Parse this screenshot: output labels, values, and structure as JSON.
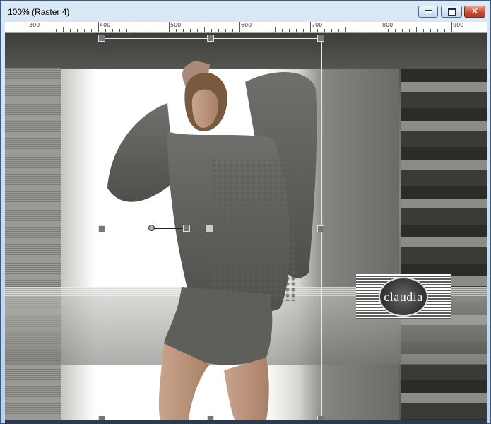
{
  "window": {
    "title": "100% (Raster 4)"
  },
  "controls": {
    "minimize": "minimize-icon",
    "maximize": "maximize-icon",
    "close": "close-icon",
    "close_glyph": "✕"
  },
  "ruler": {
    "labels": [
      "300",
      "400",
      "500",
      "600",
      "700",
      "800",
      "900"
    ]
  },
  "canvas": {
    "watermark_text": "claudia",
    "subject": "woman in grey knit sweater"
  },
  "colors": {
    "titlebar": "#dbe8f5",
    "close_button": "#c84a35",
    "canvas_bg": "#6e6e6a"
  }
}
